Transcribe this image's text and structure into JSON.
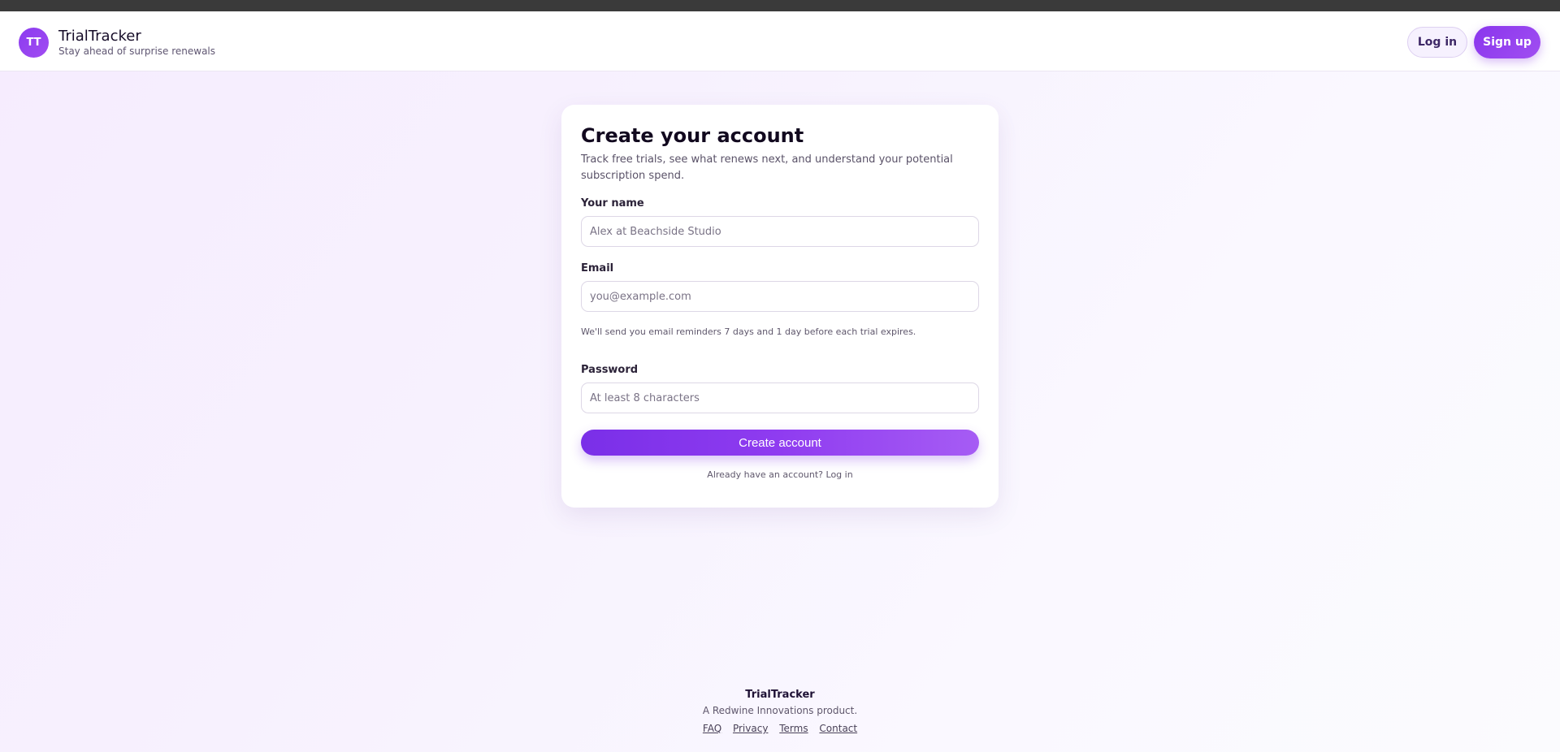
{
  "header": {
    "logo_initials": "TT",
    "brand_name": "TrialTracker",
    "tagline": "Stay ahead of surprise renewals",
    "login_label": "Log in",
    "signup_label": "Sign up"
  },
  "form": {
    "title": "Create your account",
    "subtitle": "Track free trials, see what renews next, and understand your potential subscription spend.",
    "name_label": "Your name",
    "name_placeholder": "Alex at Beachside Studio",
    "email_label": "Email",
    "email_placeholder": "you@example.com",
    "email_hint": "We'll send you email reminders 7 days and 1 day before each trial expires.",
    "password_label": "Password",
    "password_placeholder": "At least 8 characters",
    "submit_label": "Create account",
    "already_text": "Already have an account?",
    "login_link": "Log in"
  },
  "footer": {
    "brand": "TrialTracker",
    "byline": "A Redwine Innovations product.",
    "links": [
      "FAQ",
      "Privacy",
      "Terms",
      "Contact"
    ]
  },
  "colors": {
    "accent": "#8b3bf0",
    "accent_light": "#a65cf4"
  }
}
